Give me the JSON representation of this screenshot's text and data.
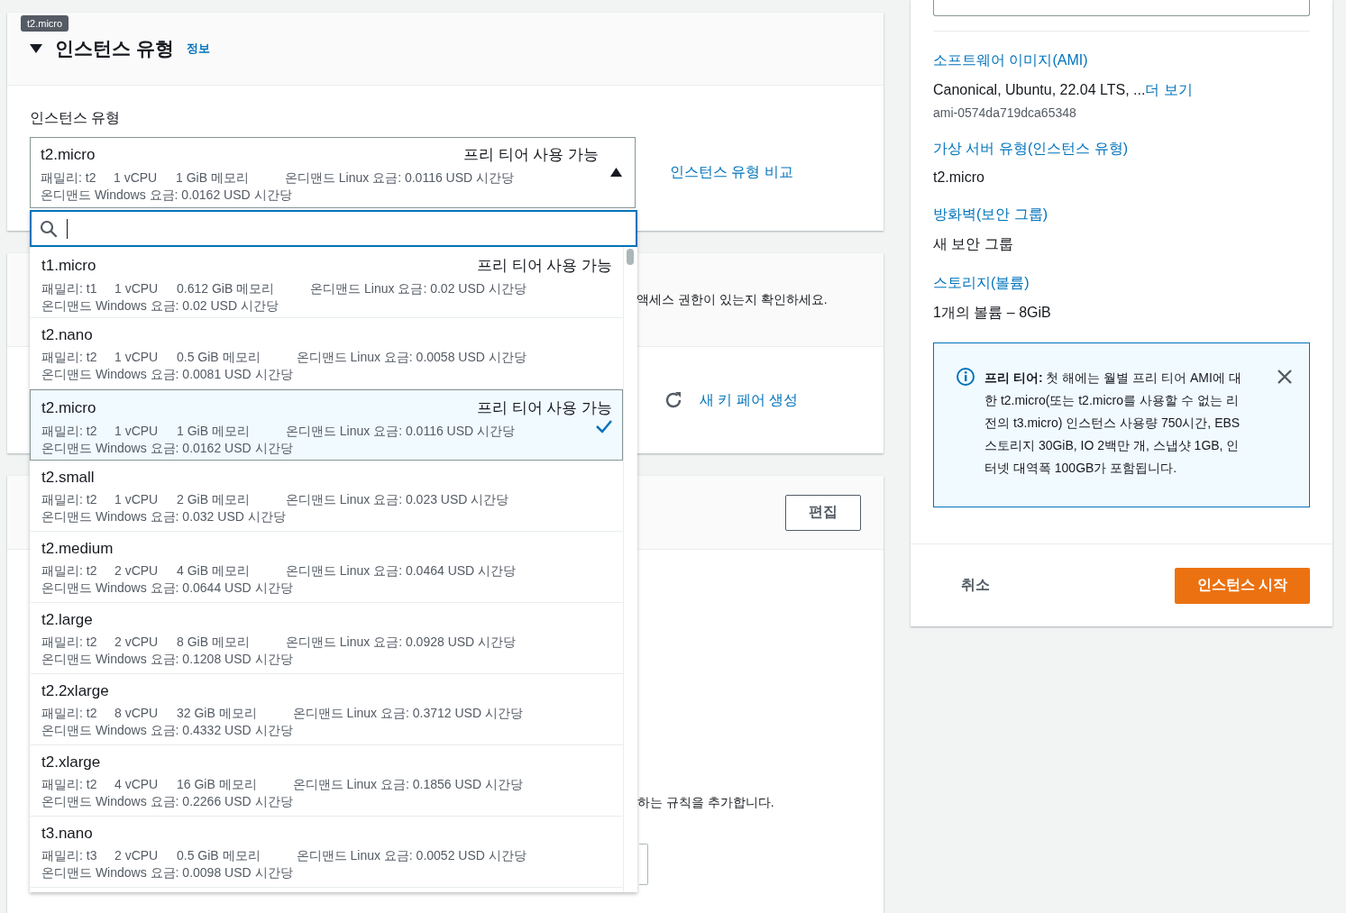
{
  "tooltip": "t2.micro",
  "instance_section": {
    "expanded": true,
    "title": "인스턴스 유형",
    "info_link": "정보",
    "field_label": "인스턴스 유형",
    "compare_link": "인스턴스 유형 비교",
    "current": {
      "name": "t2.micro",
      "free_tier_label": "프리 티어 사용 가능",
      "family": "패밀리: t2",
      "vcpu": "1 vCPU",
      "memory": "1 GiB 메모리",
      "linux": "온디맨드 Linux 요금: 0.0116 USD 시간당",
      "windows": "온디맨드 Windows 요금: 0.0162 USD 시간당"
    },
    "dropdown": {
      "open": true,
      "options": [
        {
          "name": "t1.micro",
          "free_tier_label": "프리 티어 사용 가능",
          "family": "패밀리: t1",
          "vcpu": "1 vCPU",
          "memory": "0.612 GiB 메모리",
          "linux": "온디맨드 Linux 요금: 0.02 USD 시간당",
          "windows": "온디맨드 Windows 요금: 0.02 USD 시간당",
          "selected": false
        },
        {
          "name": "t2.nano",
          "family": "패밀리: t2",
          "vcpu": "1 vCPU",
          "memory": "0.5 GiB 메모리",
          "linux": "온디맨드 Linux 요금: 0.0058 USD 시간당",
          "windows": "온디맨드 Windows 요금: 0.0081 USD 시간당",
          "selected": false
        },
        {
          "name": "t2.micro",
          "free_tier_label": "프리 티어 사용 가능",
          "family": "패밀리: t2",
          "vcpu": "1 vCPU",
          "memory": "1 GiB 메모리",
          "linux": "온디맨드 Linux 요금: 0.0116 USD 시간당",
          "windows": "온디맨드 Windows 요금: 0.0162 USD 시간당",
          "selected": true
        },
        {
          "name": "t2.small",
          "family": "패밀리: t2",
          "vcpu": "1 vCPU",
          "memory": "2 GiB 메모리",
          "linux": "온디맨드 Linux 요금: 0.023 USD 시간당",
          "windows": "온디맨드 Windows 요금: 0.032 USD 시간당",
          "selected": false
        },
        {
          "name": "t2.medium",
          "family": "패밀리: t2",
          "vcpu": "2 vCPU",
          "memory": "4 GiB 메모리",
          "linux": "온디맨드 Linux 요금: 0.0464 USD 시간당",
          "windows": "온디맨드 Windows 요금: 0.0644 USD 시간당",
          "selected": false
        },
        {
          "name": "t2.large",
          "family": "패밀리: t2",
          "vcpu": "2 vCPU",
          "memory": "8 GiB 메모리",
          "linux": "온디맨드 Linux 요금: 0.0928 USD 시간당",
          "windows": "온디맨드 Windows 요금: 0.1208 USD 시간당",
          "selected": false
        },
        {
          "name": "t2.2xlarge",
          "family": "패밀리: t2",
          "vcpu": "8 vCPU",
          "memory": "32 GiB 메모리",
          "linux": "온디맨드 Linux 요금: 0.3712 USD 시간당",
          "windows": "온디맨드 Windows 요금: 0.4332 USD 시간당",
          "selected": false
        },
        {
          "name": "t2.xlarge",
          "family": "패밀리: t2",
          "vcpu": "4 vCPU",
          "memory": "16 GiB 메모리",
          "linux": "온디맨드 Linux 요금: 0.1856 USD 시간당",
          "windows": "온디맨드 Windows 요금: 0.2266 USD 시간당",
          "selected": false
        },
        {
          "name": "t3.nano",
          "family": "패밀리: t3",
          "vcpu": "2 vCPU",
          "memory": "0.5 GiB 메모리",
          "linux": "온디맨드 Linux 요금: 0.0052 USD 시간당",
          "windows": "온디맨드 Windows 요금: 0.0098 USD 시간당",
          "selected": false
        }
      ]
    }
  },
  "key_pair_section": {
    "hint": "액세스 권한이 있는지 확인하세요.",
    "create_link": "새 키 페어 생성"
  },
  "network_section": {
    "edit_button": "편집",
    "rule_hint": "하는 규칙을 추가합니다."
  },
  "summary": {
    "items": [
      {
        "label": "소프트웨어 이미지(AMI)",
        "value": "Canonical, Ubuntu, 22.04 LTS, ...",
        "more_link": "더 보기",
        "sub": "ami-0574da719dca65348"
      },
      {
        "label": "가상 서버 유형(인스턴스 유형)",
        "value": "t2.micro"
      },
      {
        "label": "방화벽(보안 그룹)",
        "value": "새 보안 그룹"
      },
      {
        "label": "스토리지(볼륨)",
        "value": "1개의 볼륨 – 8GiB"
      }
    ],
    "notice": "**프리 티어:** 첫 해에는 월별 프리 티어 AMI에 대한 t2.micro(또는 t2.micro를 사용할 수 없는 리전의 t3.micro) 인스턴스 사용량 750시간, EBS 스토리지 30GiB, IO 2백만 개, 스냅샷 1GB, 인터넷 대역폭 100GB가 포함됩니다.",
    "cancel_button": "취소",
    "launch_button": "인스턴스 시작"
  }
}
